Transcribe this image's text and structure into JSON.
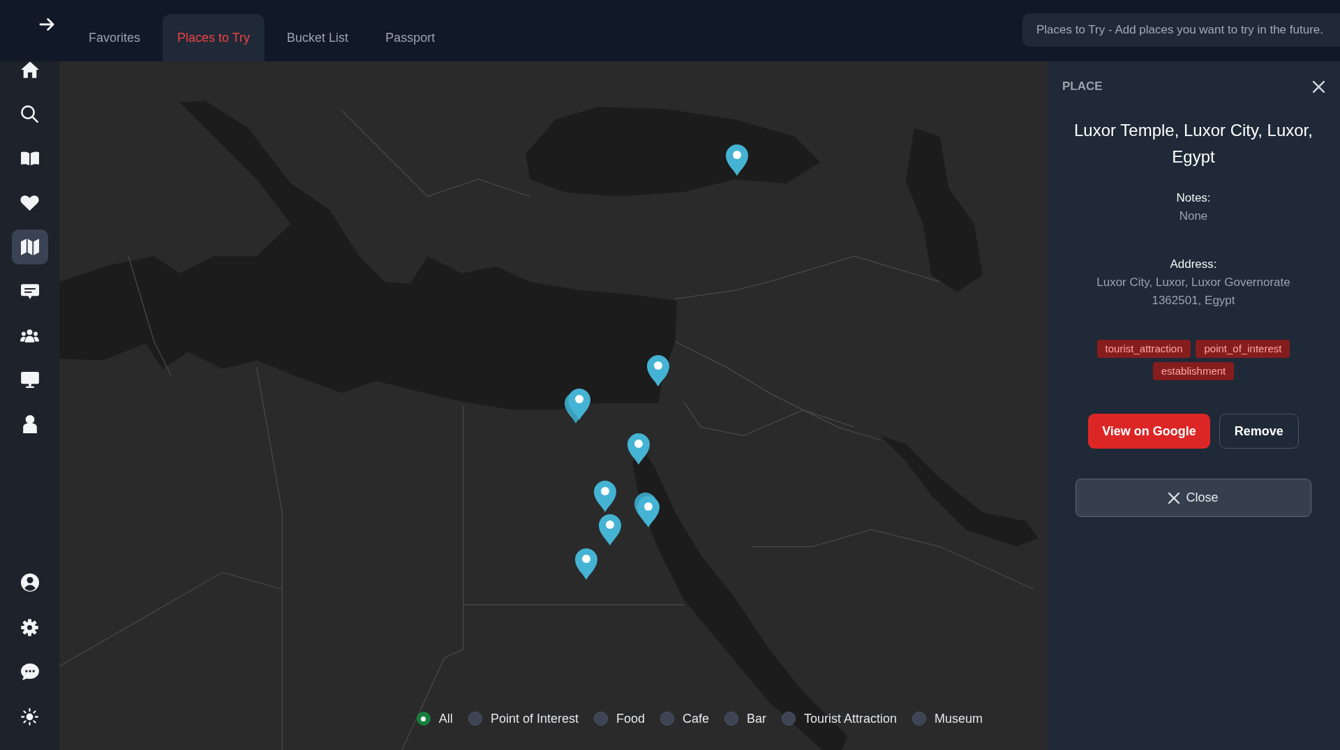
{
  "sidebar": {
    "nav_items": [
      {
        "selected": false
      },
      {
        "selected": false
      },
      {
        "selected": false
      },
      {
        "selected": false
      },
      {
        "selected": true
      },
      {
        "selected": false
      },
      {
        "selected": false
      },
      {
        "selected": false
      },
      {
        "selected": false
      }
    ]
  },
  "tabs": [
    {
      "label": "Favorites",
      "selected": false
    },
    {
      "label": "Places to Try",
      "selected": true
    },
    {
      "label": "Bucket List",
      "selected": false
    },
    {
      "label": "Passport",
      "selected": false
    }
  ],
  "info_banner": {
    "text": "Places to Try - Add places you want to try in the future."
  },
  "map": {
    "filters": [
      {
        "label": "All",
        "selected": true
      },
      {
        "label": "Point of Interest",
        "selected": false
      },
      {
        "label": "Food",
        "selected": false
      },
      {
        "label": "Cafe",
        "selected": false
      },
      {
        "label": "Bar",
        "selected": false
      },
      {
        "label": "Tourist Attraction",
        "selected": false
      },
      {
        "label": "Museum",
        "selected": false
      }
    ]
  },
  "place_panel": {
    "heading": "PLACE",
    "title": "Luxor Temple, Luxor City, Luxor, Egypt",
    "notes_label": "Notes:",
    "notes": "None",
    "address_label": "Address:",
    "address": "Luxor City, Luxor, Luxor Governorate 1362501, Egypt",
    "tags": [
      "tourist_attraction",
      "point_of_interest",
      "establishment"
    ],
    "buttons": {
      "view": "View on Google",
      "remove": "Remove"
    },
    "close_button": "Close"
  }
}
